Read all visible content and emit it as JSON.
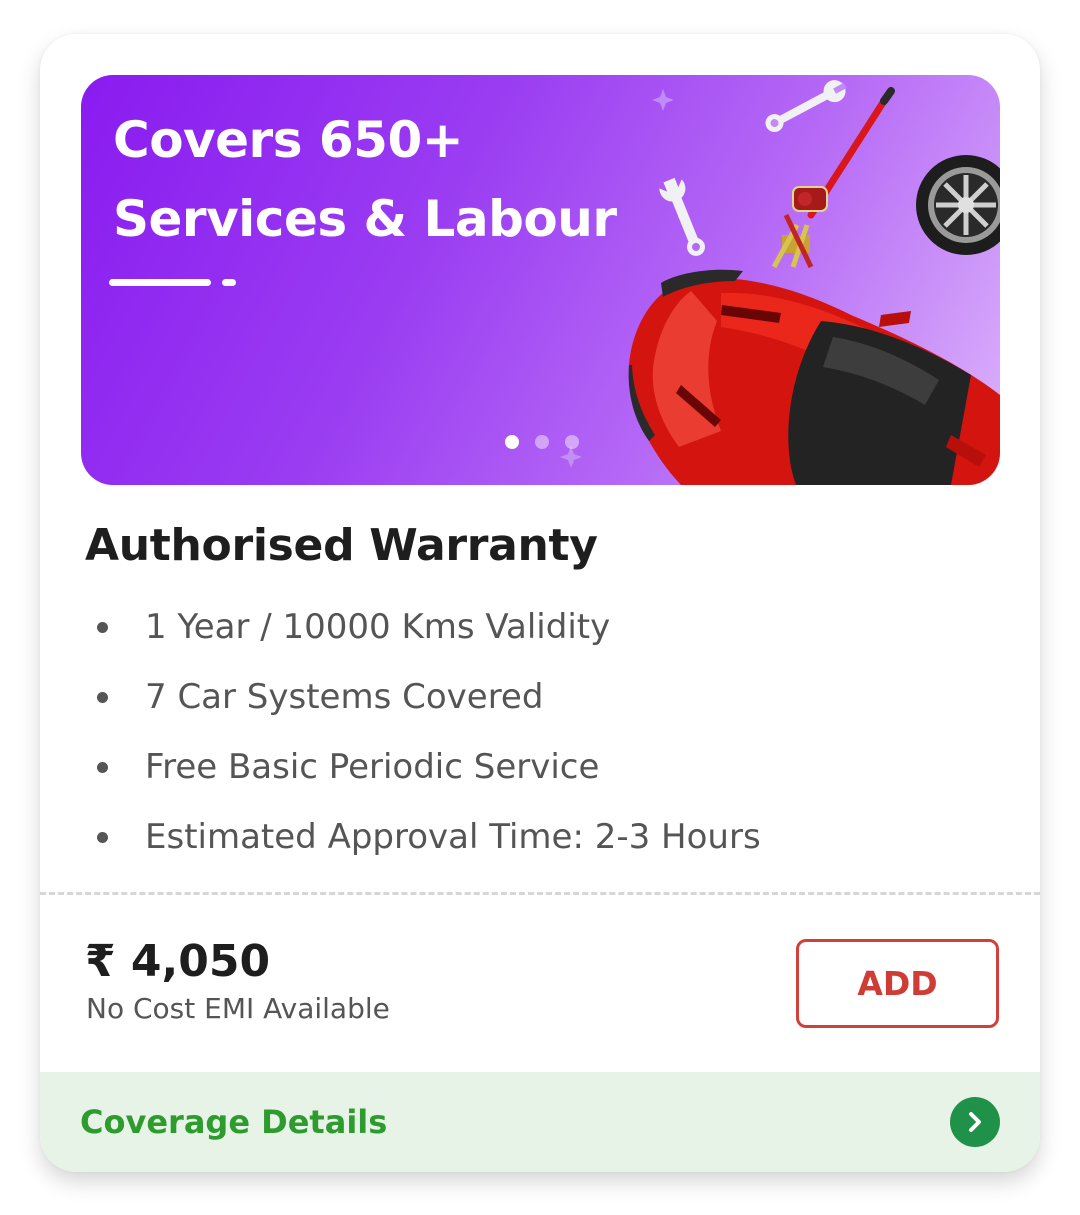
{
  "banner": {
    "line1": "Covers 650+",
    "line2": "Services & Labour",
    "illustration": "red-car-with-jack-wrenches-and-tyre",
    "slides": 3,
    "active_slide": 1,
    "colors": {
      "gradient_start": "#8a1bf0",
      "gradient_end": "#dcb4fb",
      "car": "#d4140f"
    }
  },
  "product": {
    "title": "Authorised Warranty",
    "features": [
      "1 Year / 10000 Kms Validity",
      "7 Car Systems Covered",
      "Free Basic Periodic Service",
      "Estimated Approval Time: 2-3 Hours"
    ]
  },
  "pricing": {
    "price": "₹ 4,050",
    "emi": "No Cost EMI Available",
    "add_label": "ADD",
    "add_color": "#cf3b35"
  },
  "coverage": {
    "label": "Coverage Details",
    "icon": "chevron-right-icon",
    "label_color": "#2e9b2e",
    "icon_color": "#1f9148",
    "background": "#e8f3e8"
  }
}
